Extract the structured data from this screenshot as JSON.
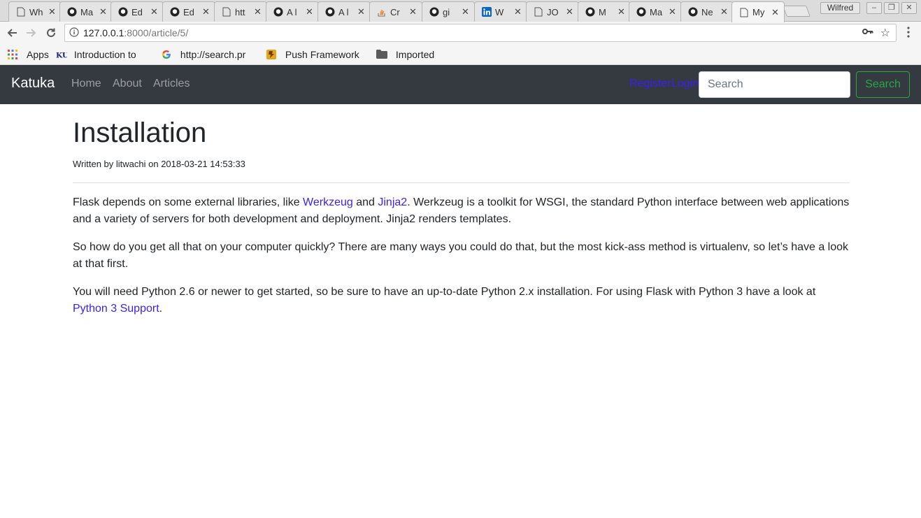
{
  "browser": {
    "tabs": [
      {
        "title": "Wh",
        "icon": "page-icon"
      },
      {
        "title": "Ma",
        "icon": "github-icon"
      },
      {
        "title": "Ed",
        "icon": "github-icon"
      },
      {
        "title": "Ed",
        "icon": "github-icon"
      },
      {
        "title": "htt",
        "icon": "page-icon"
      },
      {
        "title": "A l",
        "icon": "github-icon"
      },
      {
        "title": "A l",
        "icon": "github-icon"
      },
      {
        "title": "Cr",
        "icon": "stackoverflow-icon"
      },
      {
        "title": "gi",
        "icon": "github-icon"
      },
      {
        "title": "W",
        "icon": "linkedin-icon"
      },
      {
        "title": "JO",
        "icon": "page-icon"
      },
      {
        "title": "M",
        "icon": "github-icon"
      },
      {
        "title": "Ma",
        "icon": "github-icon"
      },
      {
        "title": "Ne",
        "icon": "github-icon"
      },
      {
        "title": "My",
        "icon": "page-icon",
        "active": true
      }
    ],
    "close_glyph": "✕",
    "profile_name": "Wilfred",
    "window_controls": {
      "minimize": "–",
      "restore": "❐",
      "close": "✕"
    },
    "address": {
      "host": "127.0.0.1",
      "path": ":8000/article/5/"
    },
    "bookmarks": [
      {
        "label": "Apps",
        "icon": "apps-grid-icon"
      },
      {
        "label": "Introduction to",
        "icon": "ku-logo-icon"
      },
      {
        "label": "http://search.pr",
        "icon": "google-icon"
      },
      {
        "label": "Push Framework",
        "icon": "push-framework-icon"
      },
      {
        "label": "Imported",
        "icon": "folder-icon"
      }
    ]
  },
  "site": {
    "brand": "Katuka",
    "nav": {
      "home": "Home",
      "about": "About",
      "articles": "Articles"
    },
    "auth": {
      "register": "Register",
      "login": "Login"
    },
    "search": {
      "placeholder": "Search",
      "button": "Search"
    }
  },
  "article": {
    "title": "Installation",
    "meta": "Written by litwachi on 2018-03-21 14:53:33",
    "p1": {
      "t1": "Flask depends on some external libraries, like ",
      "link1": "Werkzeug",
      "t2": " and ",
      "link2": "Jinja2",
      "t3": ". Werkzeug is a toolkit for WSGI, the standard Python interface between web applications and a variety of servers for both development and deployment. Jinja2 renders templates."
    },
    "p2": "So how do you get all that on your computer quickly? There are many ways you could do that, but the most kick-ass method is virtualenv, so let’s have a look at that first.",
    "p3": {
      "t1": "You will need Python 2.6 or newer to get started, so be sure to have an up-to-date Python 2.x installation. For using Flask with Python 3 have a look at ",
      "link": "Python 3 Support",
      "t2": "."
    }
  }
}
